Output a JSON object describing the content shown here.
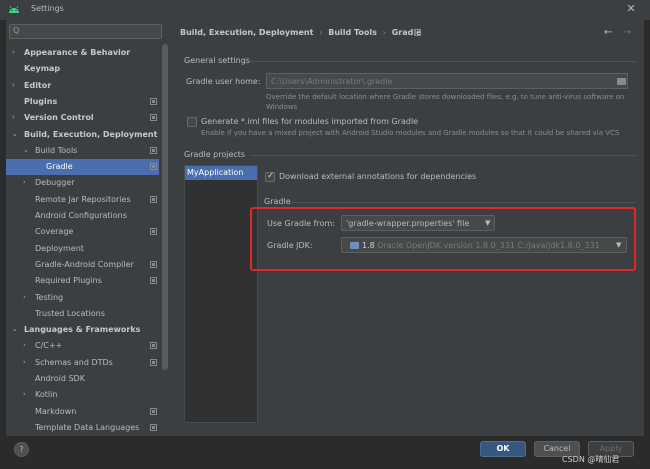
{
  "window": {
    "title": "Settings",
    "close_glyph": "✕"
  },
  "search": {
    "placeholder": "",
    "glyph": "Q"
  },
  "sidebar": {
    "items": [
      {
        "label": "Appearance & Behavior",
        "bold": true,
        "arrow": "›",
        "level": 0
      },
      {
        "label": "Keymap",
        "bold": true,
        "arrow": "",
        "level": 0
      },
      {
        "label": "Editor",
        "bold": true,
        "arrow": "›",
        "level": 0
      },
      {
        "label": "Plugins",
        "bold": true,
        "arrow": "",
        "level": 0,
        "mod": true
      },
      {
        "label": "Version Control",
        "bold": true,
        "arrow": "›",
        "level": 0,
        "mod": true
      },
      {
        "label": "Build, Execution, Deployment",
        "bold": true,
        "arrow": "⌄",
        "level": 0
      },
      {
        "label": "Build Tools",
        "bold": false,
        "arrow": "⌄",
        "level": 1,
        "mod": true
      },
      {
        "label": "Gradle",
        "bold": false,
        "arrow": "",
        "level": 2,
        "mod": true,
        "selected": true
      },
      {
        "label": "Debugger",
        "bold": false,
        "arrow": "›",
        "level": 1
      },
      {
        "label": "Remote Jar Repositories",
        "bold": false,
        "arrow": "",
        "level": 1,
        "mod": true
      },
      {
        "label": "Android Configurations",
        "bold": false,
        "arrow": "",
        "level": 1
      },
      {
        "label": "Coverage",
        "bold": false,
        "arrow": "",
        "level": 1,
        "mod": true
      },
      {
        "label": "Deployment",
        "bold": false,
        "arrow": "",
        "level": 1
      },
      {
        "label": "Gradle-Android Compiler",
        "bold": false,
        "arrow": "",
        "level": 1,
        "mod": true
      },
      {
        "label": "Required Plugins",
        "bold": false,
        "arrow": "",
        "level": 1,
        "mod": true
      },
      {
        "label": "Testing",
        "bold": false,
        "arrow": "›",
        "level": 1
      },
      {
        "label": "Trusted Locations",
        "bold": false,
        "arrow": "",
        "level": 1
      },
      {
        "label": "Languages & Frameworks",
        "bold": true,
        "arrow": "⌄",
        "level": 0
      },
      {
        "label": "C/C++",
        "bold": false,
        "arrow": "›",
        "level": 1,
        "mod": true
      },
      {
        "label": "Schemas and DTDs",
        "bold": false,
        "arrow": "›",
        "level": 1,
        "mod": true
      },
      {
        "label": "Android SDK",
        "bold": false,
        "arrow": "",
        "level": 1
      },
      {
        "label": "Kotlin",
        "bold": false,
        "arrow": "›",
        "level": 1
      },
      {
        "label": "Markdown",
        "bold": false,
        "arrow": "",
        "level": 1,
        "mod": true
      },
      {
        "label": "Template Data Languages",
        "bold": false,
        "arrow": "",
        "level": 1,
        "mod": true
      }
    ]
  },
  "breadcrumb": {
    "parts": [
      "Build, Execution, Deployment",
      "Build Tools",
      "Gradle"
    ],
    "separator": "›",
    "back_glyph": "←",
    "forward_glyph": "→"
  },
  "general": {
    "section_label": "General settings",
    "user_home_label": "Gradle user home:",
    "user_home_value": "C:\\Users\\Administrator\\.gradle",
    "user_home_hint": "Override the default location where Gradle stores downloaded files, e.g. to tune anti-virus software on Windows",
    "iml_label": "Generate *.iml files for modules imported from Gradle",
    "iml_hint": "Enable if you have a mixed project with Android Studio modules and Gradle modules so that it could be shared via VCS",
    "iml_checked": false
  },
  "projects": {
    "section_label": "Gradle projects",
    "items": [
      "MyApplication"
    ],
    "download_annotations_label": "Download external annotations for dependencies",
    "download_annotations_checked": true,
    "gradle_group_label": "Gradle",
    "use_gradle_from_label": "Use Gradle from:",
    "use_gradle_from_value": "'gradle-wrapper.properties' file",
    "gradle_jdk_label": "Gradle JDK:",
    "gradle_jdk_version": "1.8",
    "gradle_jdk_detail": "Oracle OpenJDK version 1.8.0_331 C:/Java/jdk1.8.0_331",
    "highlight_color": "#e3262a"
  },
  "footer": {
    "help_label": "?",
    "ok_label": "OK",
    "cancel_label": "Cancel",
    "apply_label": "Apply",
    "watermark": "CSDN @晴仙君"
  },
  "colors": {
    "accent": "#4b6eaf",
    "ok_button": "#365880",
    "background": "#3c3f41"
  }
}
